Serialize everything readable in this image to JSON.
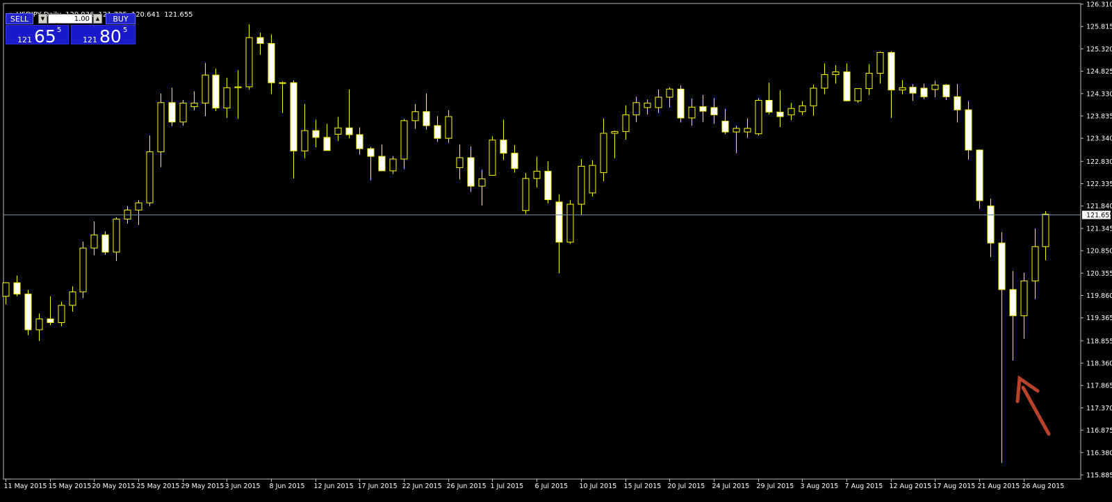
{
  "header": {
    "symbol": "USDJPY,Daily",
    "ohlc": [
      "120.936",
      "121.725",
      "120.641",
      "121.655"
    ]
  },
  "trade_panel": {
    "sell_label": "SELL",
    "buy_label": "BUY",
    "lot_value": "1.00",
    "sell_price": {
      "prefix": "121",
      "big": "65",
      "sup": "5"
    },
    "buy_price": {
      "prefix": "121",
      "big": "80",
      "sup": "5"
    }
  },
  "colors": {
    "background": "#000000",
    "candle": "#ffff00",
    "bull_fill": "#000000",
    "bear_fill": "#ffffff",
    "grid_text": "#ffffff",
    "price_line": "#6e8da6",
    "annotation_arrow": "#b8432a"
  },
  "icons": {
    "lot_down": "triangle-down-icon",
    "lot_up": "triangle-up-icon",
    "annotation": "arrow-icon"
  },
  "chart_data": {
    "type": "candlestick",
    "symbol": "USDJPY",
    "timeframe": "Daily",
    "current_price": "121.655",
    "ylim": [
      115.885,
      126.31
    ],
    "y_ticks": [
      "126.310",
      "125.815",
      "125.320",
      "124.825",
      "124.330",
      "123.835",
      "123.340",
      "122.830",
      "122.335",
      "121.840",
      "121.345",
      "120.850",
      "120.355",
      "119.860",
      "119.365",
      "118.855",
      "118.360",
      "117.865",
      "117.370",
      "116.875",
      "116.380",
      "115.885"
    ],
    "x_tick_labels": [
      "11 May 2015",
      "15 May 2015",
      "20 May 2015",
      "25 May 2015",
      "29 May 2015",
      "3 Jun 2015",
      "8 Jun 2015",
      "12 Jun 2015",
      "17 Jun 2015",
      "22 Jun 2015",
      "26 Jun 2015",
      "1 Jul 2015",
      "6 Jul 2015",
      "10 Jul 2015",
      "15 Jul 2015",
      "20 Jul 2015",
      "24 Jul 2015",
      "29 Jul 2015",
      "3 Aug 2015",
      "7 Aug 2015",
      "12 Aug 2015",
      "17 Aug 2015",
      "21 Aug 2015",
      "26 Aug 2015"
    ],
    "x_tick_index": [
      0,
      4,
      8,
      12,
      16,
      20,
      24,
      28,
      32,
      36,
      40,
      44,
      48,
      52,
      56,
      60,
      64,
      68,
      72,
      76,
      80,
      84,
      88,
      92
    ],
    "candles": [
      {
        "o": 119.84,
        "h": 120.15,
        "l": 119.66,
        "c": 120.14
      },
      {
        "o": 120.14,
        "h": 120.3,
        "l": 119.84,
        "c": 119.89
      },
      {
        "o": 119.89,
        "h": 119.98,
        "l": 118.98,
        "c": 119.1
      },
      {
        "o": 119.1,
        "h": 119.46,
        "l": 118.85,
        "c": 119.34
      },
      {
        "o": 119.34,
        "h": 119.84,
        "l": 119.2,
        "c": 119.26
      },
      {
        "o": 119.26,
        "h": 119.72,
        "l": 119.18,
        "c": 119.64
      },
      {
        "o": 119.64,
        "h": 120.06,
        "l": 119.5,
        "c": 119.94
      },
      {
        "o": 119.94,
        "h": 121.05,
        "l": 119.8,
        "c": 120.91
      },
      {
        "o": 120.91,
        "h": 121.5,
        "l": 120.75,
        "c": 121.2
      },
      {
        "o": 121.2,
        "h": 121.28,
        "l": 120.76,
        "c": 120.82
      },
      {
        "o": 120.82,
        "h": 121.59,
        "l": 120.62,
        "c": 121.55
      },
      {
        "o": 121.55,
        "h": 121.84,
        "l": 121.45,
        "c": 121.75
      },
      {
        "o": 121.75,
        "h": 121.97,
        "l": 121.42,
        "c": 121.91
      },
      {
        "o": 121.91,
        "h": 123.4,
        "l": 121.84,
        "c": 123.04
      },
      {
        "o": 123.04,
        "h": 124.33,
        "l": 122.7,
        "c": 124.13
      },
      {
        "o": 124.13,
        "h": 124.46,
        "l": 123.61,
        "c": 123.7
      },
      {
        "o": 123.7,
        "h": 124.19,
        "l": 123.62,
        "c": 124.12
      },
      {
        "o": 124.04,
        "h": 124.38,
        "l": 123.96,
        "c": 124.12
      },
      {
        "o": 124.12,
        "h": 125.01,
        "l": 123.83,
        "c": 124.74
      },
      {
        "o": 124.74,
        "h": 124.88,
        "l": 123.94,
        "c": 124.01
      },
      {
        "o": 124.01,
        "h": 124.68,
        "l": 123.79,
        "c": 124.46
      },
      {
        "o": 124.46,
        "h": 124.85,
        "l": 123.77,
        "c": 124.48
      },
      {
        "o": 124.48,
        "h": 125.86,
        "l": 124.42,
        "c": 125.57
      },
      {
        "o": 125.57,
        "h": 125.68,
        "l": 125.19,
        "c": 125.44
      },
      {
        "o": 125.44,
        "h": 125.64,
        "l": 124.32,
        "c": 124.57
      },
      {
        "o": 124.57,
        "h": 124.6,
        "l": 123.9,
        "c": 124.57
      },
      {
        "o": 124.57,
        "h": 124.62,
        "l": 122.45,
        "c": 123.06
      },
      {
        "o": 123.06,
        "h": 124.1,
        "l": 122.9,
        "c": 123.51
      },
      {
        "o": 123.51,
        "h": 123.75,
        "l": 123.14,
        "c": 123.36
      },
      {
        "o": 123.36,
        "h": 123.66,
        "l": 123.07,
        "c": 123.07
      },
      {
        "o": 123.43,
        "h": 123.81,
        "l": 123.28,
        "c": 123.57
      },
      {
        "o": 123.57,
        "h": 124.42,
        "l": 123.34,
        "c": 123.42
      },
      {
        "o": 123.42,
        "h": 123.58,
        "l": 122.98,
        "c": 123.11
      },
      {
        "o": 123.11,
        "h": 123.15,
        "l": 122.41,
        "c": 122.94
      },
      {
        "o": 122.94,
        "h": 123.2,
        "l": 122.64,
        "c": 122.62
      },
      {
        "o": 122.62,
        "h": 122.94,
        "l": 122.55,
        "c": 122.88
      },
      {
        "o": 122.88,
        "h": 123.77,
        "l": 122.66,
        "c": 123.73
      },
      {
        "o": 123.73,
        "h": 124.1,
        "l": 123.55,
        "c": 123.93
      },
      {
        "o": 123.93,
        "h": 124.33,
        "l": 123.53,
        "c": 123.62
      },
      {
        "o": 123.62,
        "h": 123.83,
        "l": 123.26,
        "c": 123.34
      },
      {
        "o": 123.34,
        "h": 123.96,
        "l": 123.24,
        "c": 123.82
      },
      {
        "o": 122.69,
        "h": 123.2,
        "l": 122.43,
        "c": 122.91
      },
      {
        "o": 122.91,
        "h": 123.16,
        "l": 122.15,
        "c": 122.28
      },
      {
        "o": 122.28,
        "h": 122.64,
        "l": 121.85,
        "c": 122.44
      },
      {
        "o": 122.52,
        "h": 123.38,
        "l": 122.51,
        "c": 123.3
      },
      {
        "o": 123.3,
        "h": 123.75,
        "l": 122.86,
        "c": 123.01
      },
      {
        "o": 123.01,
        "h": 123.19,
        "l": 122.58,
        "c": 122.67
      },
      {
        "o": 121.74,
        "h": 122.57,
        "l": 121.66,
        "c": 122.45
      },
      {
        "o": 122.45,
        "h": 122.93,
        "l": 122.25,
        "c": 122.61
      },
      {
        "o": 122.61,
        "h": 122.83,
        "l": 121.9,
        "c": 121.98
      },
      {
        "o": 121.93,
        "h": 122.1,
        "l": 120.35,
        "c": 121.04
      },
      {
        "o": 121.04,
        "h": 121.97,
        "l": 121.0,
        "c": 121.88
      },
      {
        "o": 121.88,
        "h": 122.88,
        "l": 121.64,
        "c": 122.72
      },
      {
        "o": 122.13,
        "h": 122.85,
        "l": 122.05,
        "c": 122.74
      },
      {
        "o": 122.58,
        "h": 123.78,
        "l": 122.39,
        "c": 123.45
      },
      {
        "o": 123.45,
        "h": 123.51,
        "l": 122.9,
        "c": 123.49
      },
      {
        "o": 123.49,
        "h": 124.07,
        "l": 123.31,
        "c": 123.86
      },
      {
        "o": 123.86,
        "h": 124.26,
        "l": 123.7,
        "c": 124.13
      },
      {
        "o": 124.02,
        "h": 124.2,
        "l": 123.87,
        "c": 124.12
      },
      {
        "o": 124.02,
        "h": 124.42,
        "l": 123.9,
        "c": 124.25
      },
      {
        "o": 124.25,
        "h": 124.47,
        "l": 124.02,
        "c": 124.43
      },
      {
        "o": 124.43,
        "h": 124.51,
        "l": 123.69,
        "c": 123.79
      },
      {
        "o": 123.79,
        "h": 124.22,
        "l": 123.62,
        "c": 124.03
      },
      {
        "o": 124.04,
        "h": 124.3,
        "l": 123.7,
        "c": 123.94
      },
      {
        "o": 124.02,
        "h": 124.23,
        "l": 123.66,
        "c": 123.86
      },
      {
        "o": 123.72,
        "h": 123.99,
        "l": 123.43,
        "c": 123.48
      },
      {
        "o": 123.48,
        "h": 123.62,
        "l": 123.01,
        "c": 123.56
      },
      {
        "o": 123.48,
        "h": 123.78,
        "l": 123.35,
        "c": 123.56
      },
      {
        "o": 123.44,
        "h": 124.23,
        "l": 123.4,
        "c": 124.18
      },
      {
        "o": 124.18,
        "h": 124.57,
        "l": 123.87,
        "c": 123.92
      },
      {
        "o": 123.92,
        "h": 124.4,
        "l": 123.59,
        "c": 123.82
      },
      {
        "o": 123.86,
        "h": 124.12,
        "l": 123.74,
        "c": 124.0
      },
      {
        "o": 123.93,
        "h": 124.16,
        "l": 123.85,
        "c": 124.06
      },
      {
        "o": 124.06,
        "h": 124.53,
        "l": 123.84,
        "c": 124.45
      },
      {
        "o": 124.45,
        "h": 125.0,
        "l": 124.32,
        "c": 124.75
      },
      {
        "o": 124.75,
        "h": 124.96,
        "l": 124.55,
        "c": 124.81
      },
      {
        "o": 124.81,
        "h": 125.0,
        "l": 124.16,
        "c": 124.17
      },
      {
        "o": 124.17,
        "h": 124.44,
        "l": 124.12,
        "c": 124.44
      },
      {
        "o": 124.44,
        "h": 124.98,
        "l": 124.3,
        "c": 124.78
      },
      {
        "o": 124.78,
        "h": 125.26,
        "l": 124.55,
        "c": 125.24
      },
      {
        "o": 125.24,
        "h": 125.27,
        "l": 123.79,
        "c": 124.41
      },
      {
        "o": 124.41,
        "h": 124.63,
        "l": 124.31,
        "c": 124.46
      },
      {
        "o": 124.47,
        "h": 124.54,
        "l": 124.17,
        "c": 124.34
      },
      {
        "o": 124.45,
        "h": 124.55,
        "l": 124.21,
        "c": 124.26
      },
      {
        "o": 124.42,
        "h": 124.61,
        "l": 124.25,
        "c": 124.52
      },
      {
        "o": 124.52,
        "h": 124.54,
        "l": 124.19,
        "c": 124.26
      },
      {
        "o": 124.26,
        "h": 124.54,
        "l": 123.69,
        "c": 123.97
      },
      {
        "o": 123.97,
        "h": 124.16,
        "l": 122.87,
        "c": 123.08
      },
      {
        "o": 123.08,
        "h": 123.09,
        "l": 121.78,
        "c": 121.96
      },
      {
        "o": 121.84,
        "h": 122.0,
        "l": 120.71,
        "c": 121.02
      },
      {
        "o": 121.02,
        "h": 121.26,
        "l": 116.15,
        "c": 119.99
      },
      {
        "o": 119.99,
        "h": 120.4,
        "l": 118.42,
        "c": 119.41
      },
      {
        "o": 119.41,
        "h": 120.36,
        "l": 118.9,
        "c": 120.18
      },
      {
        "o": 120.18,
        "h": 121.34,
        "l": 119.78,
        "c": 120.94
      },
      {
        "o": 120.94,
        "h": 121.73,
        "l": 120.64,
        "c": 121.66
      }
    ]
  }
}
